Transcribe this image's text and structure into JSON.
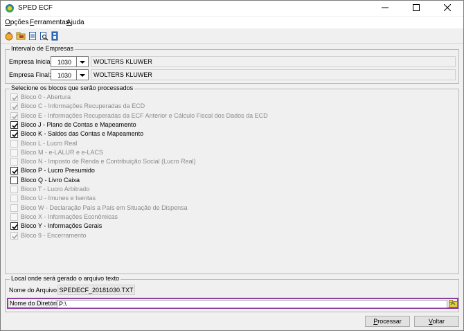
{
  "window": {
    "title": "SPED ECF"
  },
  "menu": {
    "opcoes": "Opções",
    "ferramentas": "Ferramentas",
    "ajuda": "Ajuda"
  },
  "toolbar": {
    "icons": [
      "run-icon",
      "open-folder-icon",
      "document-icon",
      "search-document-icon",
      "save-icon"
    ]
  },
  "empresas": {
    "group_label": "Intervalo de Empresas",
    "inicial": {
      "label": "Empresa Inicial:",
      "code": "1030",
      "name": "WOLTERS KLUWER"
    },
    "final": {
      "label": "Empresa Final:",
      "code": "1030",
      "name": "WOLTERS KLUWER"
    }
  },
  "blocos": {
    "group_label": "Selecione os blocos que serão processados",
    "items": [
      {
        "label": "Bloco 0 - Abertura",
        "checked": true,
        "enabled": false
      },
      {
        "label": "Bloco C - Informações Recuperadas da ECD",
        "checked": true,
        "enabled": false
      },
      {
        "label": "Bloco E - Informações Recuperadas da ECF Anterior e Cálculo Fiscal dos Dados da ECD",
        "checked": true,
        "enabled": false
      },
      {
        "label": "Bloco J - Plano de Contas e Mapeamento",
        "checked": true,
        "enabled": true
      },
      {
        "label": "Bloco K - Saldos das Contas e Mapeamento",
        "checked": true,
        "enabled": true
      },
      {
        "label": "Bloco L - Lucro Real",
        "checked": false,
        "enabled": false
      },
      {
        "label": "Bloco M - e-LALUR e e-LACS",
        "checked": false,
        "enabled": false
      },
      {
        "label": "Bloco N - Imposto de Renda e Contribuição Social (Lucro Real)",
        "checked": false,
        "enabled": false
      },
      {
        "label": "Bloco P - Lucro Presumido",
        "checked": true,
        "enabled": true
      },
      {
        "label": "Bloco Q - Livro Caixa",
        "checked": false,
        "enabled": true
      },
      {
        "label": "Bloco T - Lucro Arbitrado",
        "checked": false,
        "enabled": false
      },
      {
        "label": "Bloco U - Imunes e Isentas",
        "checked": false,
        "enabled": false
      },
      {
        "label": "Bloco W - Declaração País a País em Situação de Dispensa",
        "checked": false,
        "enabled": false
      },
      {
        "label": "Bloco X - Informações Econômicas",
        "checked": false,
        "enabled": false
      },
      {
        "label": "Bloco Y - Informações Gerais",
        "checked": true,
        "enabled": true
      },
      {
        "label": "Bloco 9 - Encerramento",
        "checked": true,
        "enabled": false
      }
    ]
  },
  "output": {
    "group_label": "Local onde será gerado o arquivo texto",
    "file_label": "Nome do Arquivo:",
    "file_name": "SPEDECF_20181030.TXT",
    "dir_label": "Nome do Diretório:",
    "dir_value": "P:\\"
  },
  "buttons": {
    "processar": "Processar",
    "voltar": "Voltar"
  },
  "colors": {
    "highlight_border": "#8e3da0",
    "disabled_text": "#8a8a8a"
  }
}
